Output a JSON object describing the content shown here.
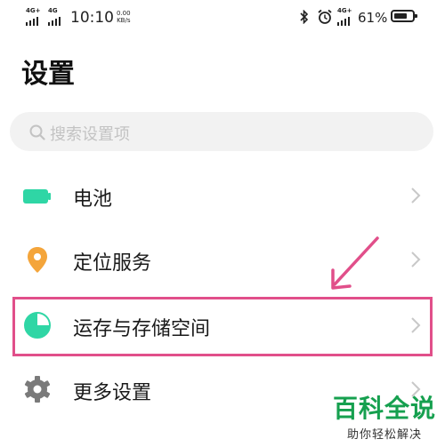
{
  "status_bar": {
    "sim1_type": "4G+",
    "sim2_type": "4G",
    "time": "10:10",
    "speed_value": "0.00",
    "speed_unit": "KB/s",
    "right_network": "4G+",
    "battery_percent": "61%",
    "icons": [
      "bluetooth-icon",
      "alarm-icon",
      "battery-icon"
    ]
  },
  "page": {
    "title": "设置"
  },
  "search": {
    "placeholder": "搜索设置项"
  },
  "settings_items": [
    {
      "label": "电池",
      "icon": "battery-icon",
      "color": "#2fd6a5"
    },
    {
      "label": "定位服务",
      "icon": "location-pin-icon",
      "color": "#f4a53b"
    },
    {
      "label": "运存与存储空间",
      "icon": "pie-chart-icon",
      "color": "#2fd6a5",
      "highlighted": true
    },
    {
      "label": "更多设置",
      "icon": "gear-icon",
      "color": "#7a7a7a"
    }
  ],
  "annotation": {
    "color": "#e14f8a"
  },
  "watermark": {
    "brand": "百科全说",
    "tagline": "助你轻松解决"
  }
}
